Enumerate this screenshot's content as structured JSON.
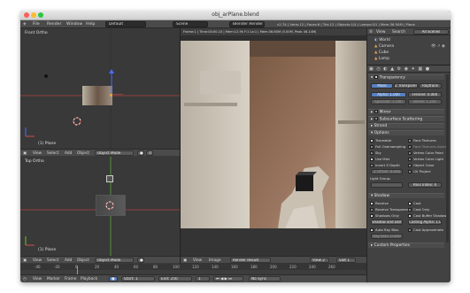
{
  "window": {
    "title": "obj_arPlane.blend"
  },
  "topbar": {
    "menus": [
      "File",
      "Render",
      "Window",
      "Help"
    ],
    "layout": "Default",
    "scene": "Scene",
    "engine": "Blender Render",
    "stats": "v2.74 | Verts:12 | Faces:6 | Tris:12 | Objects:1/4 | Lamps:0/1 | Mem:36.50M | Plane"
  },
  "viewport_top": {
    "label": "Front Ortho",
    "object_label": "(1) Plane"
  },
  "viewport_bottom": {
    "label": "Top Ortho",
    "object_label": "(1) Plane"
  },
  "header": {
    "view": "View",
    "select": "Select",
    "add": "Add",
    "object": "Object",
    "mode": "Object Mode",
    "global": "Global"
  },
  "image_header": {
    "view": "View",
    "image": "Image",
    "result": "Render Result",
    "slot": "Slot 1",
    "view_layer": "View 2"
  },
  "render_info": "Frame:1 | Time:00:00.10 | Mem:12.9k F:1 La:1 | Mem:36.60M (0.00M, Peak 46.14M)",
  "outliner": {
    "tabs": [
      "View",
      "Search",
      "All Scenes"
    ],
    "items": [
      "World",
      "Camera",
      "Cube",
      "Lamp"
    ]
  },
  "properties": {
    "transparency": "Transparency",
    "modes": [
      "Mask",
      "Z Transparency",
      "Raytrace"
    ],
    "alpha_label": "Alpha: 1.000",
    "fresnel_label": "Fresnel: 0.000",
    "specular_label": "Specular: 1.000",
    "blend_label": "Blend: 1.250",
    "mirror": "Mirror",
    "sss": "Subsurface Scattering",
    "strand": "Strand",
    "options": "Options",
    "options_left": [
      "Traceable",
      "Full Oversampling",
      "Sky",
      "Use Mist",
      "Invert Z Depth",
      "Z Offset: 0.000",
      "Light Group:"
    ],
    "options_right": [
      "Face Textures",
      "Face Textures Alpha",
      "Vertex Color Paint",
      "Vertex Color Light",
      "Object Color",
      "UV Project",
      "Pass Index: 0"
    ],
    "shadow": "Shadow",
    "shadow_left": [
      "Receive",
      "Receive Transparent",
      "Shadows Only",
      "Shadow and Distance",
      "Auto Ray Bias",
      "Ray Bias: 0.000"
    ],
    "shadow_right": [
      "Cast",
      "Cast Only",
      "Cast Buffer Shadows",
      "Casting Alpha: 1.000",
      "Cast Approximate"
    ],
    "custom": "Custom Properties"
  },
  "timeline": {
    "ticks": [
      "-40",
      "-20",
      "0",
      "20",
      "40",
      "60",
      "80",
      "100",
      "120",
      "140",
      "160",
      "180",
      "200",
      "220",
      "240",
      "260"
    ],
    "menus": [
      "View",
      "Marker",
      "Frame",
      "Playback"
    ],
    "start": "Start:",
    "start_val": "1",
    "end": "End:",
    "end_val": "250",
    "current": "1",
    "sync": "No Sync"
  },
  "colors": {
    "accent": "#5680c2",
    "axis_red": "#d44a4a",
    "axis_green": "#6ec030"
  }
}
